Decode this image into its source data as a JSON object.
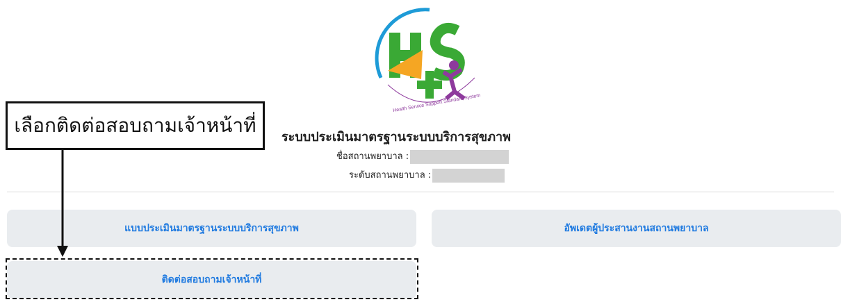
{
  "header": {
    "system_title": "ระบบประเมินมาตรฐานระบบบริการสุขภาพ",
    "hospital_name_label": "ชื่อสถานพยาบาล :",
    "hospital_level_label": "ระดับสถานพยาบาล :"
  },
  "logo": {
    "text": "HS4",
    "tagline": "Health Service Support Standard System",
    "colors": {
      "primary": "#3aa935",
      "accent": "#8e3a9d",
      "ring": "#1e9bd7",
      "highlight": "#f5a623"
    }
  },
  "menu": {
    "assessment_button": "แบบประเมินมาตรฐานระบบบริการสุขภาพ",
    "update_coordinator_button": "อัพเดตผู้ประสานงานสถานพยาบาล",
    "contact_staff_button": "ติดต่อสอบถามเจ้าหน้าที่"
  },
  "annotation": {
    "callout_text": "เลือกติดต่อสอบถามเจ้าหน้าที่"
  },
  "colors": {
    "button_bg": "#e9ecef",
    "button_text": "#1f7ae0",
    "divider": "#d9d9d9"
  }
}
